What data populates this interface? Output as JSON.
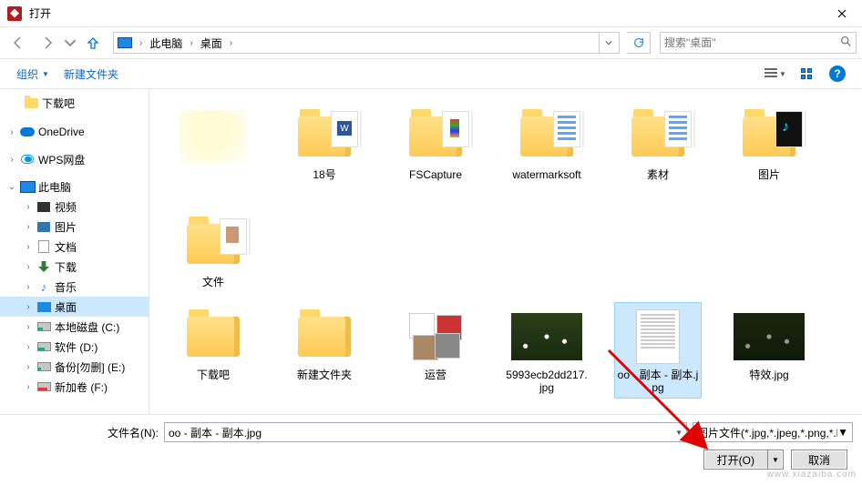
{
  "title": "打开",
  "breadcrumb": {
    "root": "此电脑",
    "leaf": "桌面"
  },
  "search": {
    "placeholder": "搜索\"桌面\""
  },
  "toolbar": {
    "organize": "组织",
    "newfolder": "新建文件夹"
  },
  "sidebar": {
    "downloads": "下载吧",
    "onedrive": "OneDrive",
    "wps": "WPS网盘",
    "thispc": "此电脑",
    "video": "视频",
    "pictures": "图片",
    "documents": "文档",
    "dl": "下载",
    "music": "音乐",
    "desktop": "桌面",
    "diskc": "本地磁盘 (C:)",
    "diskd": "软件 (D:)",
    "diske": "备份[勿删] (E:)",
    "diskf": "新加卷 (F:)"
  },
  "items": {
    "r1": [
      "",
      "18号",
      "FSCapture",
      "watermarksoft",
      "素材",
      "图片",
      "文件"
    ],
    "r2": [
      "下载吧",
      "新建文件夹",
      "运营",
      "5993ecb2dd217.jpg",
      "oo - 副本 - 副本.jpg",
      "特效.jpg"
    ]
  },
  "footer": {
    "fnlabel": "文件名(N):",
    "fnvalue": "oo - 副本 - 副本.jpg",
    "filter": "图片文件(*.jpg,*.jpeg,*.png,*.bmp)",
    "open": "打开(O)",
    "cancel": "取消"
  },
  "watermark": "www.xiazaiba.com"
}
